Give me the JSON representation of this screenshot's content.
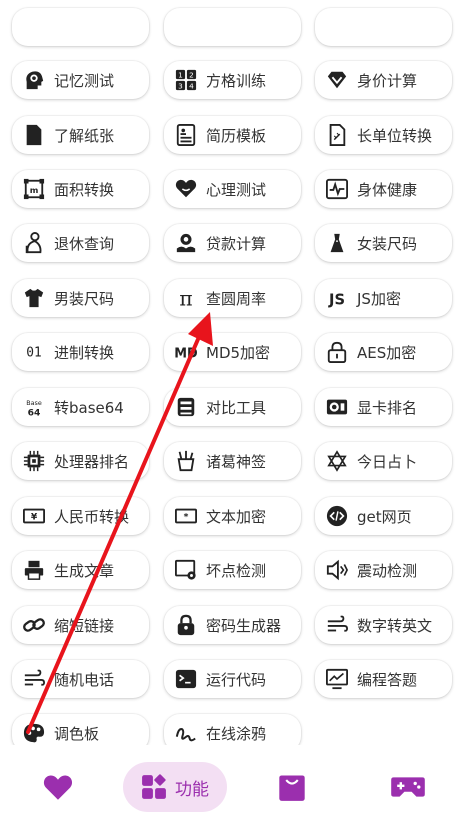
{
  "colors": {
    "accent": "#9b2fae",
    "active_bg": "#f3dff3",
    "text": "#333333",
    "annotation_arrow": "#e8141c"
  },
  "rows": [
    [
      {
        "label": "记忆测试",
        "icon": "brain-head-icon"
      },
      {
        "label": "方格训练",
        "icon": "number-grid-icon"
      },
      {
        "label": "身价计算",
        "icon": "diamond-icon"
      }
    ],
    [
      {
        "label": "了解纸张",
        "icon": "paper-sheet-icon"
      },
      {
        "label": "简历模板",
        "icon": "resume-icon"
      },
      {
        "label": "长单位转换",
        "icon": "ruler-doc-icon"
      }
    ],
    [
      {
        "label": "面积转换",
        "icon": "area-frame-icon"
      },
      {
        "label": "心理测试",
        "icon": "heart-icon"
      },
      {
        "label": "身体健康",
        "icon": "pulse-chart-icon"
      }
    ],
    [
      {
        "label": "退休查询",
        "icon": "elder-person-icon"
      },
      {
        "label": "贷款计算",
        "icon": "loan-hand-icon"
      },
      {
        "label": "女装尺码",
        "icon": "dress-icon"
      }
    ],
    [
      {
        "label": "男装尺码",
        "icon": "tshirt-icon"
      },
      {
        "label": "查圆周率",
        "icon": "pi-icon"
      },
      {
        "label": "JS加密",
        "icon": "js-icon"
      }
    ],
    [
      {
        "label": "进制转换",
        "icon": "binary-icon"
      },
      {
        "label": "MD5加密",
        "icon": "md5-icon"
      },
      {
        "label": "AES加密",
        "icon": "lock-icon"
      }
    ],
    [
      {
        "label": "转base64",
        "icon": "base64-icon"
      },
      {
        "label": "对比工具",
        "icon": "compare-icon"
      },
      {
        "label": "显卡排名",
        "icon": "gpu-icon"
      }
    ],
    [
      {
        "label": "处理器排名",
        "icon": "cpu-icon"
      },
      {
        "label": "诸葛神签",
        "icon": "fortune-jar-icon"
      },
      {
        "label": "今日占卜",
        "icon": "star-of-david-icon"
      }
    ],
    [
      {
        "label": "人民币转换",
        "icon": "banknote-icon"
      },
      {
        "label": "文本加密",
        "icon": "text-encrypt-icon"
      },
      {
        "label": "get网页",
        "icon": "code-icon"
      }
    ],
    [
      {
        "label": "生成文章",
        "icon": "printer-icon"
      },
      {
        "label": "坏点检测",
        "icon": "screen-gear-icon"
      },
      {
        "label": "震动检测",
        "icon": "vibrate-icon"
      }
    ],
    [
      {
        "label": "缩短链接",
        "icon": "link-icon"
      },
      {
        "label": "密码生成器",
        "icon": "padlock-icon"
      },
      {
        "label": "数字转英文",
        "icon": "wind-icon"
      }
    ],
    [
      {
        "label": "随机电话",
        "icon": "wind-icon"
      },
      {
        "label": "运行代码",
        "icon": "terminal-icon"
      },
      {
        "label": "编程答题",
        "icon": "monitor-chart-icon"
      }
    ],
    [
      {
        "label": "调色板",
        "icon": "palette-icon"
      },
      {
        "label": "在线涂鸦",
        "icon": "scribble-icon"
      }
    ]
  ],
  "bottom_nav": [
    {
      "icon": "heart-icon",
      "label": ""
    },
    {
      "icon": "grid-shapes-icon",
      "label": "功能"
    },
    {
      "icon": "shopping-bag-icon",
      "label": ""
    },
    {
      "icon": "gamepad-icon",
      "label": ""
    }
  ]
}
